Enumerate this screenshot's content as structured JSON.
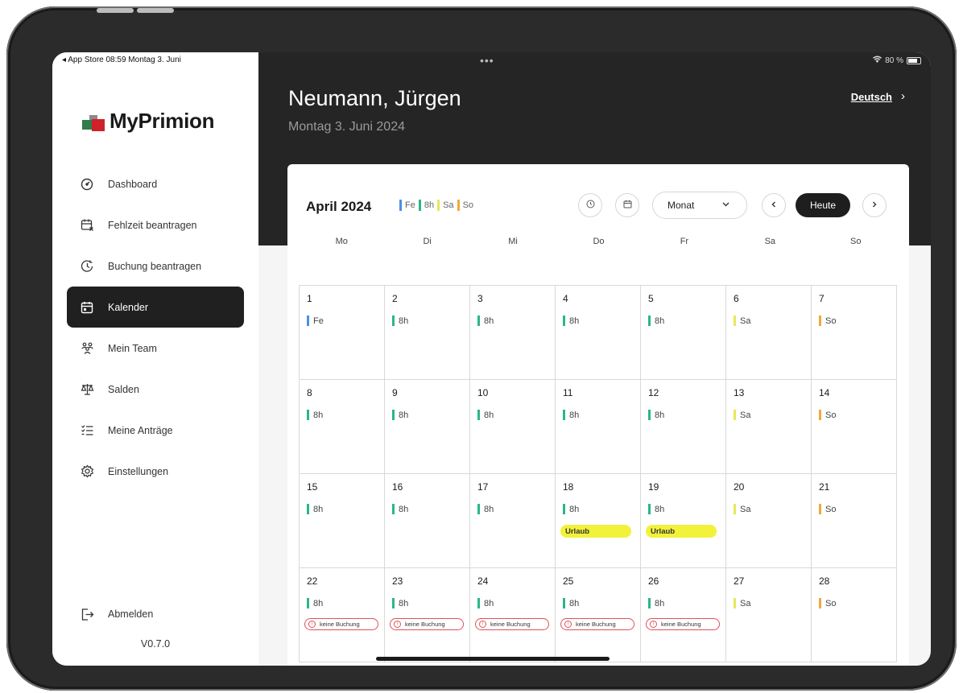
{
  "status_bar": {
    "left": "◂ App Store  08:59  Montag 3. Juni",
    "center": "•••",
    "battery": "80 %"
  },
  "brand": {
    "name": "MyPrimion"
  },
  "nav": {
    "items": [
      {
        "label": "Dashboard",
        "icon": "gauge-icon",
        "active": false
      },
      {
        "label": "Fehlzeit beantragen",
        "icon": "calendar-x-icon",
        "active": false
      },
      {
        "label": "Buchung beantragen",
        "icon": "clock-arrow-icon",
        "active": false
      },
      {
        "label": "Kalender",
        "icon": "calendar-icon",
        "active": true
      },
      {
        "label": "Mein Team",
        "icon": "team-icon",
        "active": false
      },
      {
        "label": "Salden",
        "icon": "scale-icon",
        "active": false
      },
      {
        "label": "Meine Anträge",
        "icon": "checklist-icon",
        "active": false
      },
      {
        "label": "Einstellungen",
        "icon": "gear-icon",
        "active": false
      }
    ],
    "logout_label": "Abmelden",
    "version": "V0.7.0"
  },
  "header": {
    "user_name": "Neumann, Jürgen",
    "date": "Montag 3. Juni 2024",
    "language": "Deutsch",
    "language_arrow": "›"
  },
  "calendar": {
    "title": "April 2024",
    "legend": [
      {
        "label": "Fe",
        "color": "#4a90e2"
      },
      {
        "label": "8h",
        "color": "#2bb58a"
      },
      {
        "label": "Sa",
        "color": "#e6e85a"
      },
      {
        "label": "So",
        "color": "#f2a93b"
      }
    ],
    "view_label": "Monat",
    "today_label": "Heute",
    "weekdays": [
      "Mo",
      "Di",
      "Mi",
      "Do",
      "Fr",
      "Sa",
      "So"
    ],
    "colors": {
      "Fe": "#4a90e2",
      "8h": "#2bb58a",
      "Sa": "#e6e85a",
      "So": "#f2a93b",
      "vacation": "#f2f23a",
      "warning": "#e0505a"
    },
    "days": [
      {
        "day": "1",
        "tag": "Fe"
      },
      {
        "day": "2",
        "tag": "8h"
      },
      {
        "day": "3",
        "tag": "8h"
      },
      {
        "day": "4",
        "tag": "8h"
      },
      {
        "day": "5",
        "tag": "8h"
      },
      {
        "day": "6",
        "tag": "Sa"
      },
      {
        "day": "7",
        "tag": "So"
      },
      {
        "day": "8",
        "tag": "8h"
      },
      {
        "day": "9",
        "tag": "8h"
      },
      {
        "day": "10",
        "tag": "8h"
      },
      {
        "day": "11",
        "tag": "8h"
      },
      {
        "day": "12",
        "tag": "8h"
      },
      {
        "day": "13",
        "tag": "Sa"
      },
      {
        "day": "14",
        "tag": "So"
      },
      {
        "day": "15",
        "tag": "8h"
      },
      {
        "day": "16",
        "tag": "8h"
      },
      {
        "day": "17",
        "tag": "8h"
      },
      {
        "day": "18",
        "tag": "8h",
        "event": "Urlaub"
      },
      {
        "day": "19",
        "tag": "8h",
        "event": "Urlaub"
      },
      {
        "day": "20",
        "tag": "Sa"
      },
      {
        "day": "21",
        "tag": "So"
      },
      {
        "day": "22",
        "tag": "8h",
        "warning": "keine Buchung"
      },
      {
        "day": "23",
        "tag": "8h",
        "warning": "keine Buchung"
      },
      {
        "day": "24",
        "tag": "8h",
        "warning": "keine Buchung"
      },
      {
        "day": "25",
        "tag": "8h",
        "warning": "keine Buchung"
      },
      {
        "day": "26",
        "tag": "8h",
        "warning": "keine Buchung"
      },
      {
        "day": "27",
        "tag": "Sa"
      },
      {
        "day": "28",
        "tag": "So"
      }
    ]
  }
}
